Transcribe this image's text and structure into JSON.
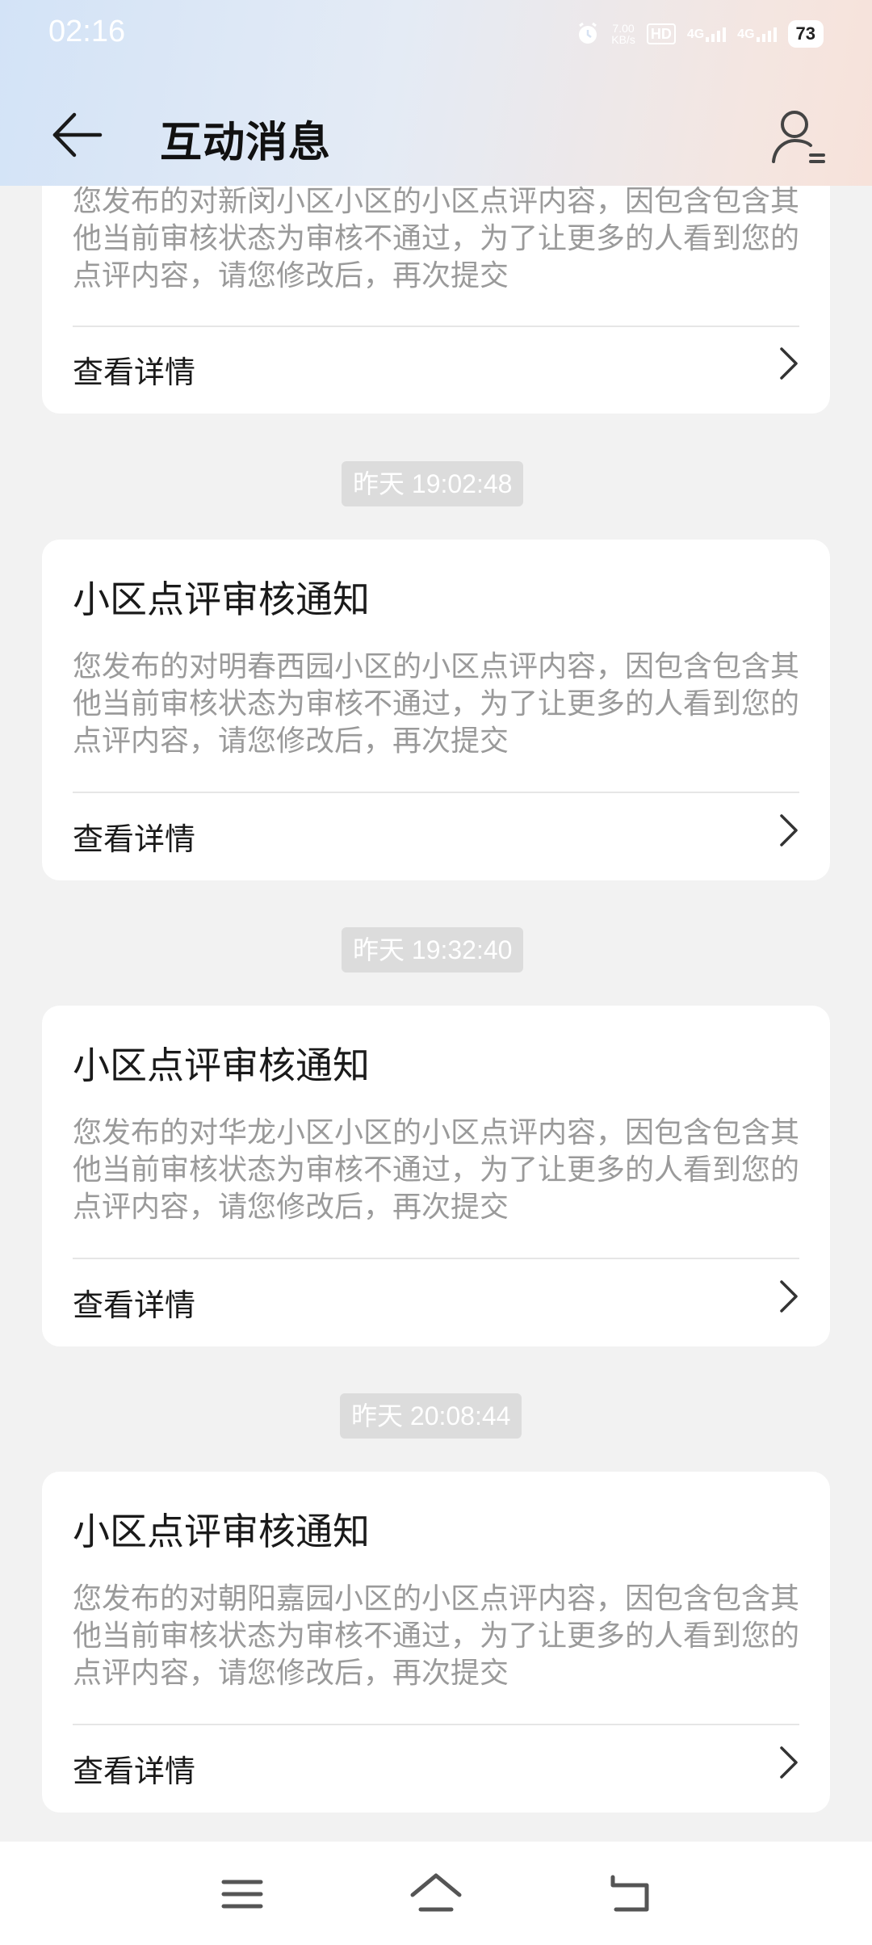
{
  "status_bar": {
    "time": "02:16",
    "net_speed_value": "7.00",
    "net_speed_unit": "KB/s",
    "hd_label": "HD",
    "network1": "4G",
    "network2": "4G",
    "battery": "73"
  },
  "header": {
    "title": "互动消息"
  },
  "messages": [
    {
      "timestamp": "",
      "title": "",
      "body": "您发布的对新闵小区小区的小区点评内容，因包含包含其他当前审核状态为审核不通过，为了让更多的人看到您的点评内容，请您修改后，再次提交",
      "link_label": "查看详情"
    },
    {
      "timestamp": "昨天 19:02:48",
      "title": "小区点评审核通知",
      "body": "您发布的对明春西园小区的小区点评内容，因包含包含其他当前审核状态为审核不通过，为了让更多的人看到您的点评内容，请您修改后，再次提交",
      "link_label": "查看详情"
    },
    {
      "timestamp": "昨天 19:32:40",
      "title": "小区点评审核通知",
      "body": "您发布的对华龙小区小区的小区点评内容，因包含包含其他当前审核状态为审核不通过，为了让更多的人看到您的点评内容，请您修改后，再次提交",
      "link_label": "查看详情"
    },
    {
      "timestamp": "昨天 20:08:44",
      "title": "小区点评审核通知",
      "body": "您发布的对朝阳嘉园小区的小区点评内容，因包含包含其他当前审核状态为审核不通过，为了让更多的人看到您的点评内容，请您修改后，再次提交",
      "link_label": "查看详情"
    }
  ],
  "icons": {
    "back": "back-arrow-icon",
    "profile": "user-profile-icon",
    "chevron": "chevron-right-icon",
    "menu": "menu-icon",
    "home": "home-icon",
    "back_nav": "back-nav-icon"
  },
  "colors": {
    "background": "#f2f2f2",
    "card": "#ffffff",
    "body_text": "#9a9a9a",
    "timestamp_bg": "#dcdcdc"
  }
}
